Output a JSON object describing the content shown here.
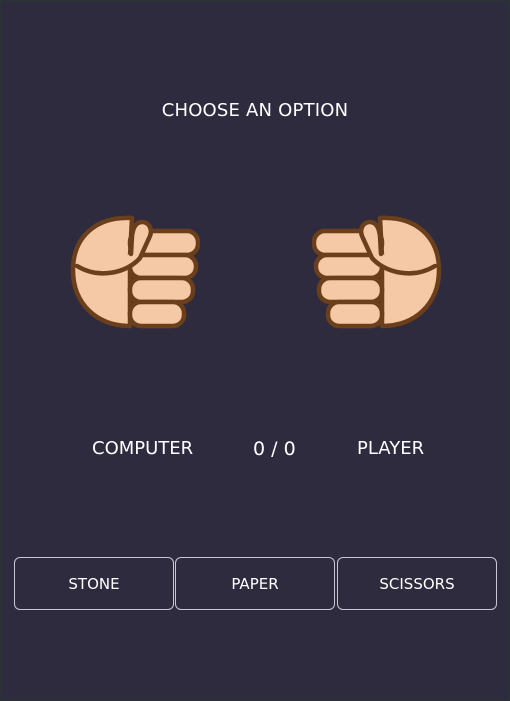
{
  "game": {
    "prompt": "CHOOSE AN OPTION",
    "computer_label": "COMPUTER",
    "score": "0 / 0",
    "player_label": "PLAYER",
    "computer_hand": "stone-fist-icon",
    "player_hand": "stone-fist-icon"
  },
  "choices": [
    {
      "label": "STONE"
    },
    {
      "label": "PAPER"
    },
    {
      "label": "SCISSORS"
    }
  ],
  "colors": {
    "background": "#2e2b3f",
    "text": "#ffffff",
    "button_border": "#c9c7d2",
    "skin": "#f5c9a5",
    "skin_outline": "#6b3e1c"
  }
}
